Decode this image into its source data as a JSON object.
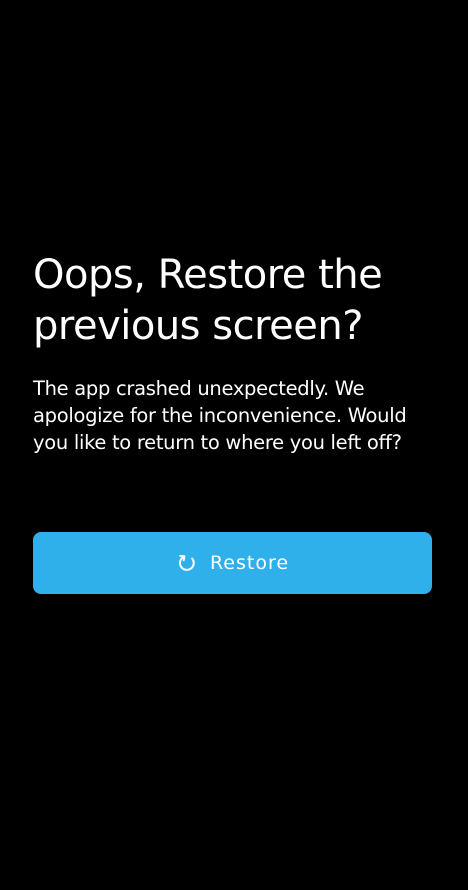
{
  "crash_dialog": {
    "title": "Oops, Restore the previous screen?",
    "message": "The app crashed unexpectedly. We apologize for the inconvenience. Would you like to return to where you left off?",
    "restore_button": {
      "label": "Restore",
      "icon": "restore-icon",
      "color": "#2fb0ea"
    },
    "background_color": "#000000"
  }
}
